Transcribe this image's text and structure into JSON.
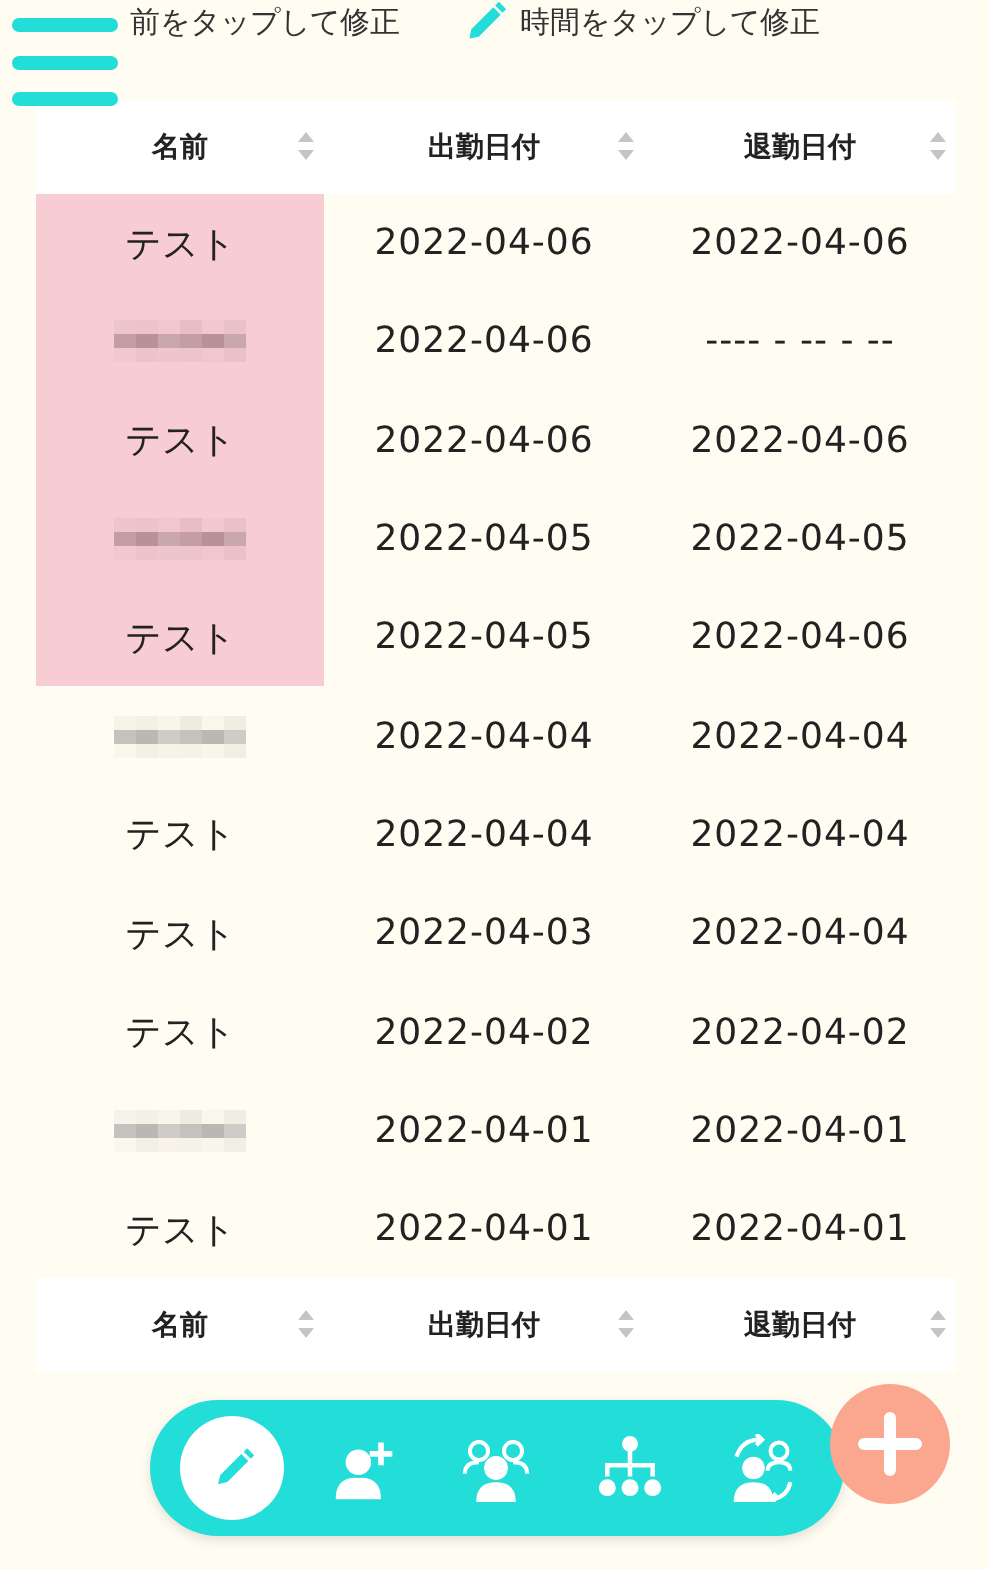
{
  "hints": [
    {
      "kind": "plain",
      "text": "前をタップして修正"
    },
    {
      "kind": "pencil",
      "text": "時間をタップして修正"
    }
  ],
  "table": {
    "columns": [
      "名前",
      "出勤日付",
      "退勤日付"
    ],
    "rows": [
      {
        "kind": "text",
        "name": "テスト",
        "highlighted": true,
        "in": "2022-04-06",
        "out": "2022-04-06"
      },
      {
        "kind": "mosaic",
        "highlighted": true,
        "in": "2022-04-06",
        "out": "---- - -- - --"
      },
      {
        "kind": "text",
        "name": "テスト",
        "highlighted": true,
        "in": "2022-04-06",
        "out": "2022-04-06"
      },
      {
        "kind": "mosaic",
        "highlighted": true,
        "in": "2022-04-05",
        "out": "2022-04-05"
      },
      {
        "kind": "text",
        "name": "テスト",
        "highlighted": true,
        "in": "2022-04-05",
        "out": "2022-04-06"
      },
      {
        "kind": "mosaic",
        "highlighted": false,
        "in": "2022-04-04",
        "out": "2022-04-04"
      },
      {
        "kind": "text",
        "name": "テスト",
        "highlighted": false,
        "in": "2022-04-04",
        "out": "2022-04-04"
      },
      {
        "kind": "text",
        "name": "テスト",
        "highlighted": false,
        "in": "2022-04-03",
        "out": "2022-04-04"
      },
      {
        "kind": "text",
        "name": "テスト",
        "highlighted": false,
        "in": "2022-04-02",
        "out": "2022-04-02"
      },
      {
        "kind": "mosaic",
        "highlighted": false,
        "in": "2022-04-01",
        "out": "2022-04-01"
      },
      {
        "kind": "text",
        "name": "テスト",
        "highlighted": false,
        "in": "2022-04-01",
        "out": "2022-04-01"
      }
    ],
    "footer_columns": [
      "名前",
      "出勤日付",
      "退勤日付"
    ]
  },
  "nav": [
    {
      "kind": "edit",
      "selected": true
    },
    {
      "kind": "add-user",
      "selected": false
    },
    {
      "kind": "group",
      "selected": false
    },
    {
      "kind": "org",
      "selected": false
    },
    {
      "kind": "swap",
      "selected": false
    }
  ]
}
